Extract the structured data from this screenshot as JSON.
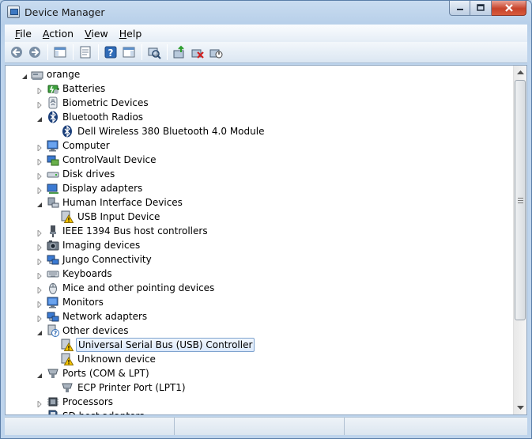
{
  "window": {
    "title": "Device Manager"
  },
  "menu": [
    {
      "label": "File",
      "accel": "F",
      "rest": "ile"
    },
    {
      "label": "Action",
      "accel": "A",
      "rest": "ction"
    },
    {
      "label": "View",
      "accel": "V",
      "rest": "iew"
    },
    {
      "label": "Help",
      "accel": "H",
      "rest": "elp"
    }
  ],
  "toolbar": [
    "back-icon",
    "forward-icon",
    "sep",
    "console-tree-icon",
    "sep",
    "properties-icon",
    "sep",
    "help-icon",
    "action-pane-icon",
    "sep",
    "scan-hardware-icon",
    "sep",
    "update-driver-icon",
    "uninstall-icon",
    "disable-device-icon"
  ],
  "tree": [
    {
      "label": "orange",
      "level": 0,
      "expander": "open",
      "icon": "computer-root-icon"
    },
    {
      "label": "Batteries",
      "level": 1,
      "expander": "closed",
      "icon": "battery-icon"
    },
    {
      "label": "Biometric Devices",
      "level": 1,
      "expander": "closed",
      "icon": "biometric-icon"
    },
    {
      "label": "Bluetooth Radios",
      "level": 1,
      "expander": "open",
      "icon": "bluetooth-icon"
    },
    {
      "label": "Dell Wireless 380 Bluetooth 4.0 Module",
      "level": 2,
      "expander": "none",
      "icon": "bluetooth-icon"
    },
    {
      "label": "Computer",
      "level": 1,
      "expander": "closed",
      "icon": "monitor-icon"
    },
    {
      "label": "ControlVault Device",
      "level": 1,
      "expander": "closed",
      "icon": "controlvault-icon"
    },
    {
      "label": "Disk drives",
      "level": 1,
      "expander": "closed",
      "icon": "disk-drive-icon"
    },
    {
      "label": "Display adapters",
      "level": 1,
      "expander": "closed",
      "icon": "display-adapter-icon"
    },
    {
      "label": "Human Interface Devices",
      "level": 1,
      "expander": "open",
      "icon": "hid-icon"
    },
    {
      "label": "USB Input Device",
      "level": 2,
      "expander": "none",
      "icon": "warning-device-icon"
    },
    {
      "label": "IEEE 1394 Bus host controllers",
      "level": 1,
      "expander": "closed",
      "icon": "firewire-icon"
    },
    {
      "label": "Imaging devices",
      "level": 1,
      "expander": "closed",
      "icon": "camera-icon"
    },
    {
      "label": "Jungo Connectivity",
      "level": 1,
      "expander": "closed",
      "icon": "network-device-icon"
    },
    {
      "label": "Keyboards",
      "level": 1,
      "expander": "closed",
      "icon": "keyboard-icon"
    },
    {
      "label": "Mice and other pointing devices",
      "level": 1,
      "expander": "closed",
      "icon": "mouse-icon"
    },
    {
      "label": "Monitors",
      "level": 1,
      "expander": "closed",
      "icon": "monitor-icon"
    },
    {
      "label": "Network adapters",
      "level": 1,
      "expander": "closed",
      "icon": "network-device-icon"
    },
    {
      "label": "Other devices",
      "level": 1,
      "expander": "open",
      "icon": "unknown-device-icon"
    },
    {
      "label": "Universal Serial Bus (USB) Controller",
      "level": 2,
      "expander": "none",
      "icon": "warning-device-icon",
      "selected": true
    },
    {
      "label": "Unknown device",
      "level": 2,
      "expander": "none",
      "icon": "warning-device-icon"
    },
    {
      "label": "Ports (COM & LPT)",
      "level": 1,
      "expander": "open",
      "icon": "port-icon"
    },
    {
      "label": "ECP Printer Port (LPT1)",
      "level": 2,
      "expander": "none",
      "icon": "port-icon"
    },
    {
      "label": "Processors",
      "level": 1,
      "expander": "closed",
      "icon": "processor-icon"
    },
    {
      "label": "SD host adapters",
      "level": 1,
      "expander": "closed",
      "icon": "sd-host-icon"
    }
  ],
  "colors": {
    "selection_border": "#7da2ce",
    "selection_fill": "#dbe9fb",
    "warning": "#f5c400",
    "window_frame": "#b7cfe9"
  }
}
